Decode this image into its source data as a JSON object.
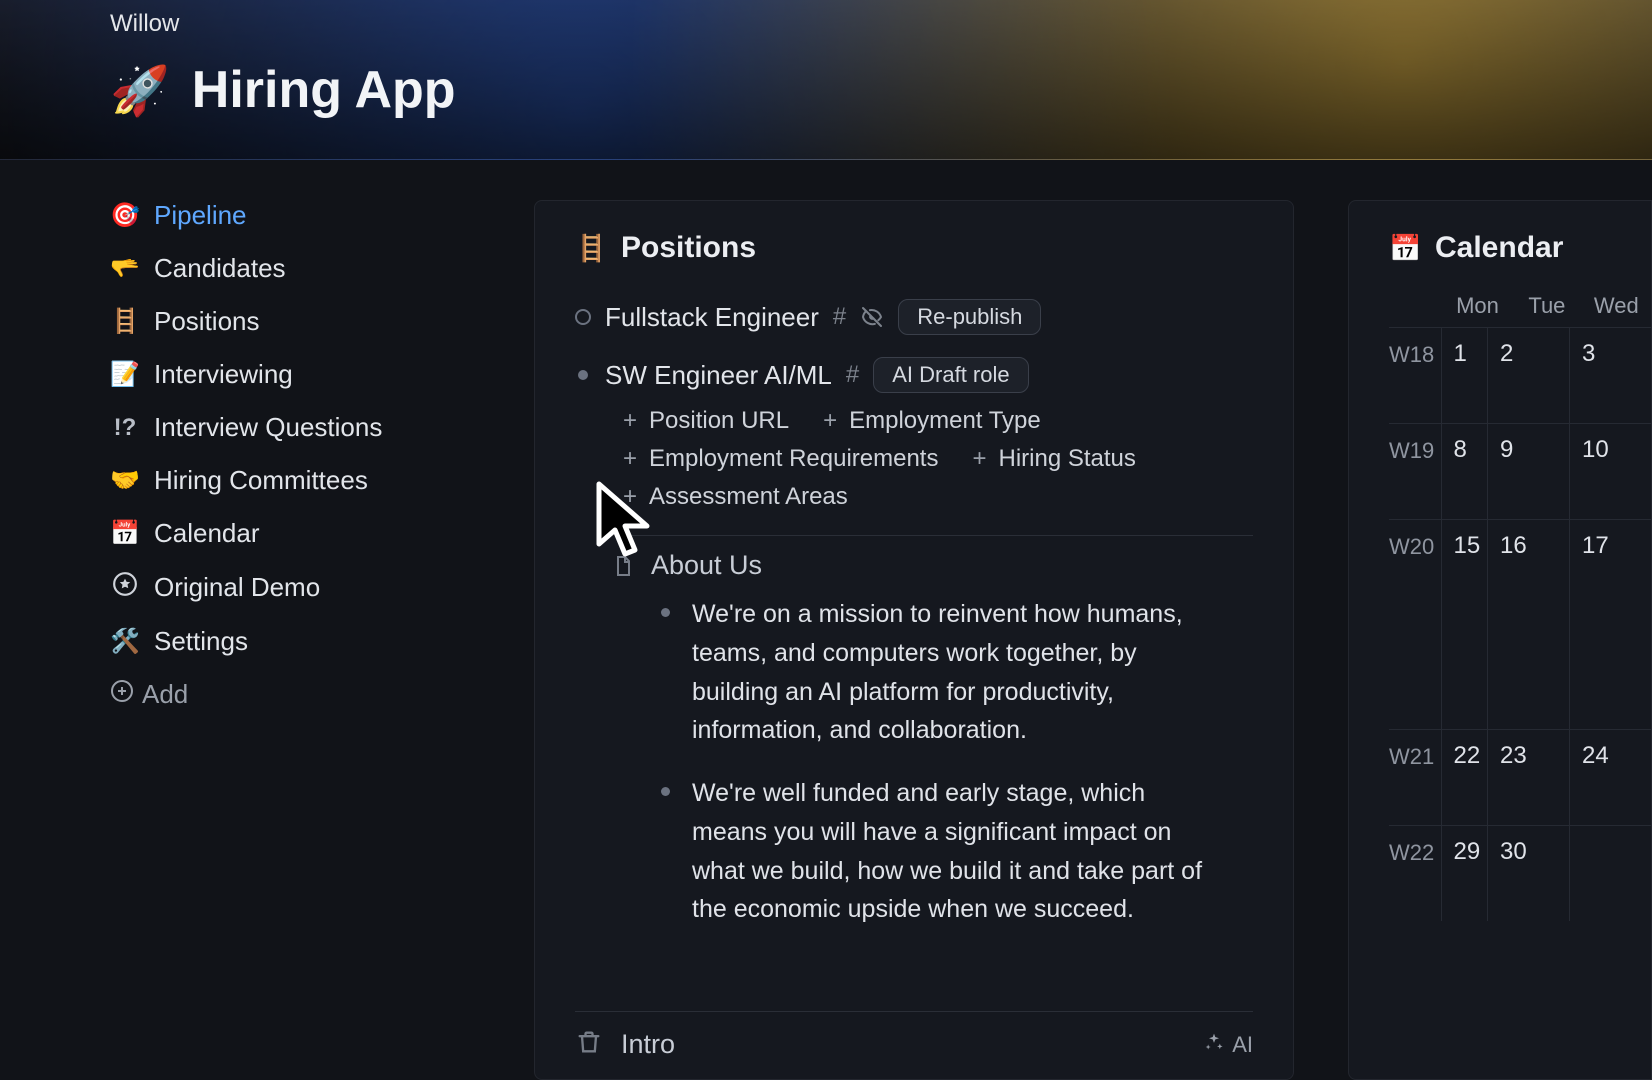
{
  "workspace": "Willow",
  "page": {
    "emoji": "🚀",
    "title": "Hiring App"
  },
  "nav": {
    "items": [
      {
        "emoji": "🎯",
        "label": "Pipeline",
        "active": true
      },
      {
        "emoji": "🫳",
        "label": "Candidates",
        "active": false
      },
      {
        "emoji": "🪜",
        "label": "Positions",
        "active": false
      },
      {
        "emoji": "📝",
        "label": "Interviewing",
        "active": false
      },
      {
        "prefix": "!?",
        "label": "Interview Questions",
        "active": false
      },
      {
        "emoji": "🤝",
        "label": "Hiring Committees",
        "active": false
      },
      {
        "emoji": "📅",
        "label": "Calendar",
        "active": false
      },
      {
        "icon": "star-circle",
        "label": "Original Demo",
        "active": false
      },
      {
        "emoji": "🛠️",
        "label": "Settings",
        "active": false
      }
    ],
    "add_label": "Add"
  },
  "positions_section": {
    "emoji": "🪜",
    "title": "Positions",
    "items": [
      {
        "title": "Fullstack Engineer",
        "has_hash": true,
        "hidden_icon": true,
        "action": "Re-publish"
      },
      {
        "title": "SW Engineer AI/ML",
        "has_hash": true,
        "hidden_icon": false,
        "action": "AI Draft role"
      }
    ],
    "fields": [
      "Position URL",
      "Employment Type",
      "Employment Requirements",
      "Hiring Status",
      "Assessment Areas"
    ],
    "about": {
      "heading": "About Us",
      "bullets": [
        "We're on a mission to reinvent how humans, teams, and computers work together, by building an AI platform for productivity, information, and collaboration.",
        "We're well funded and early stage, which means you will have a significant impact on what we build, how we build it and take part of the economic upside when we succeed."
      ]
    },
    "intro": {
      "label": "Intro",
      "ai_label": "AI"
    }
  },
  "calendar": {
    "emoji": "📅",
    "title": "Calendar",
    "day_headers": [
      "Mon",
      "Tue",
      "Wed"
    ],
    "weeks": [
      {
        "wk": "W18",
        "days": [
          "1",
          "2",
          "3"
        ],
        "tall": false
      },
      {
        "wk": "W19",
        "days": [
          "8",
          "9",
          "10"
        ],
        "tall": false
      },
      {
        "wk": "W20",
        "days": [
          "15",
          "16",
          "17"
        ],
        "tall": true
      },
      {
        "wk": "W21",
        "days": [
          "22",
          "23",
          "24"
        ],
        "tall": false
      },
      {
        "wk": "W22",
        "days": [
          "29",
          "30",
          ""
        ],
        "tall": false
      }
    ]
  }
}
